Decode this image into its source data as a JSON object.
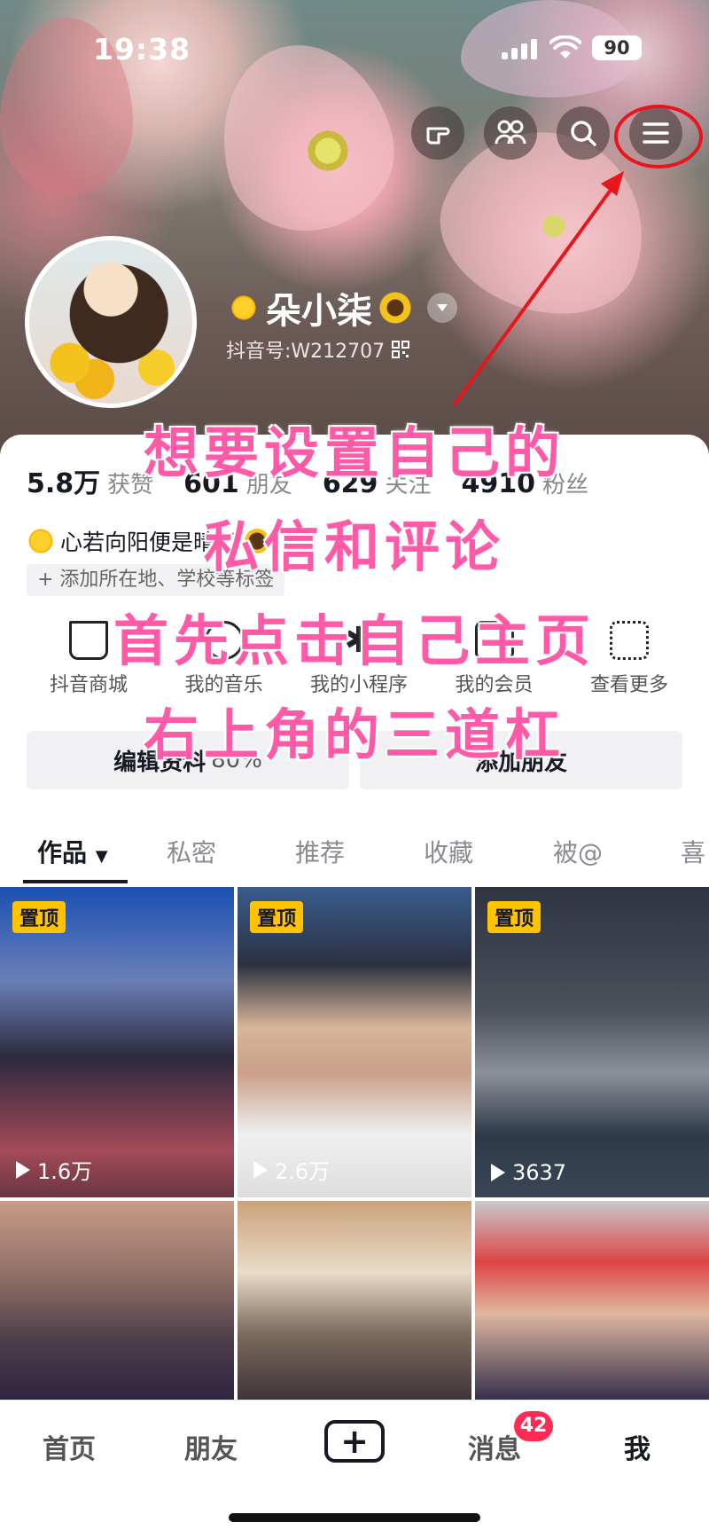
{
  "status_bar": {
    "time": "19:38",
    "battery": "90"
  },
  "profile": {
    "name": "朵小柒",
    "douyin_id": "抖音号:W212707",
    "stats": [
      {
        "value": "5.8万",
        "label": "获赞"
      },
      {
        "value": "601",
        "label": "朋友"
      },
      {
        "value": "629",
        "label": "关注"
      },
      {
        "value": "4910",
        "label": "粉丝"
      }
    ],
    "signature": "心若向阳便是晴天",
    "add_tag": "+ 添加所在地、学校等标签"
  },
  "shortcuts": [
    "抖音商城",
    "我的音乐",
    "我的小程序",
    "我的会员",
    "查看更多"
  ],
  "buttons": {
    "edit": "编辑资料",
    "edit_progress": "80%",
    "add_friend": "添加朋友"
  },
  "tabs": [
    "作品",
    "私密",
    "推荐",
    "收藏",
    "被@",
    "喜"
  ],
  "videos": [
    {
      "pinned": "置顶",
      "views": "1.6万"
    },
    {
      "pinned": "置顶",
      "views": "2.6万"
    },
    {
      "pinned": "置顶",
      "views": "3637"
    },
    {
      "pinned": "",
      "views": ""
    },
    {
      "pinned": "",
      "views": ""
    },
    {
      "pinned": "",
      "views": ""
    }
  ],
  "annotation_lines": [
    "想要设置自己的",
    "私信和评论",
    "首先点击自己主页",
    "右上角的三道杠"
  ],
  "bottom_nav": {
    "home": "首页",
    "friends": "朋友",
    "messages": "消息",
    "messages_badge": "42",
    "me": "我"
  },
  "colors": {
    "accent": "#fe2c55",
    "pin": "#ffc300",
    "annotation": "#ff5aa8",
    "highlight_circle": "#e8151c"
  }
}
